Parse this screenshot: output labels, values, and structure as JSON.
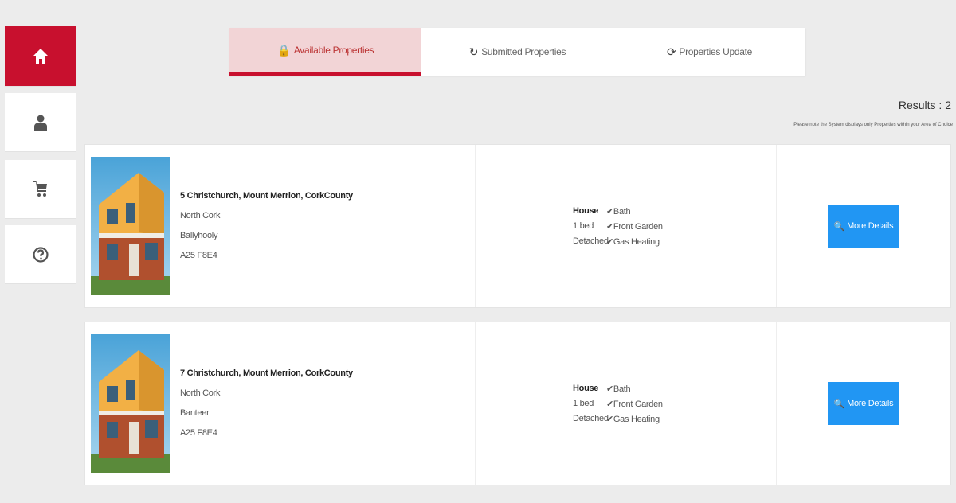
{
  "sidebar": {
    "items": [
      {
        "name": "home",
        "active": true
      },
      {
        "name": "user",
        "active": false
      },
      {
        "name": "cart",
        "active": false
      },
      {
        "name": "help",
        "active": false
      }
    ]
  },
  "tabs": [
    {
      "label": "Available Properties",
      "icon": "lock-icon"
    },
    {
      "label": "Submitted Properties",
      "icon": "refresh-icon"
    },
    {
      "label": "Properties Update",
      "icon": "sync-icon"
    }
  ],
  "results": {
    "label": "Results : 2",
    "note": "Please note the System displays only Properties within your Area of Choice"
  },
  "properties": [
    {
      "address": "5 Christchurch, Mount Merrion, CorkCounty",
      "region": "North Cork",
      "town": "Ballyhooly",
      "eircode": "A25 F8E4",
      "type": "House",
      "beds": "1 bed",
      "style": "Detached",
      "feature1": "✔Bath",
      "feature2": "✔Front Garden",
      "feature3": "✔Gas Heating",
      "button": "More Details"
    },
    {
      "address": "7 Christchurch, Mount Merrion, CorkCounty",
      "region": "North Cork",
      "town": "Banteer",
      "eircode": "A25 F8E4",
      "type": "House",
      "beds": "1 bed",
      "style": "Detached",
      "feature1": "✔Bath",
      "feature2": "✔Front Garden",
      "feature3": "✔Gas Heating",
      "button": "More Details"
    }
  ],
  "colors": {
    "accent": "#c8102e",
    "button": "#2196f3",
    "active_tab_bg": "#f2d4d6"
  }
}
